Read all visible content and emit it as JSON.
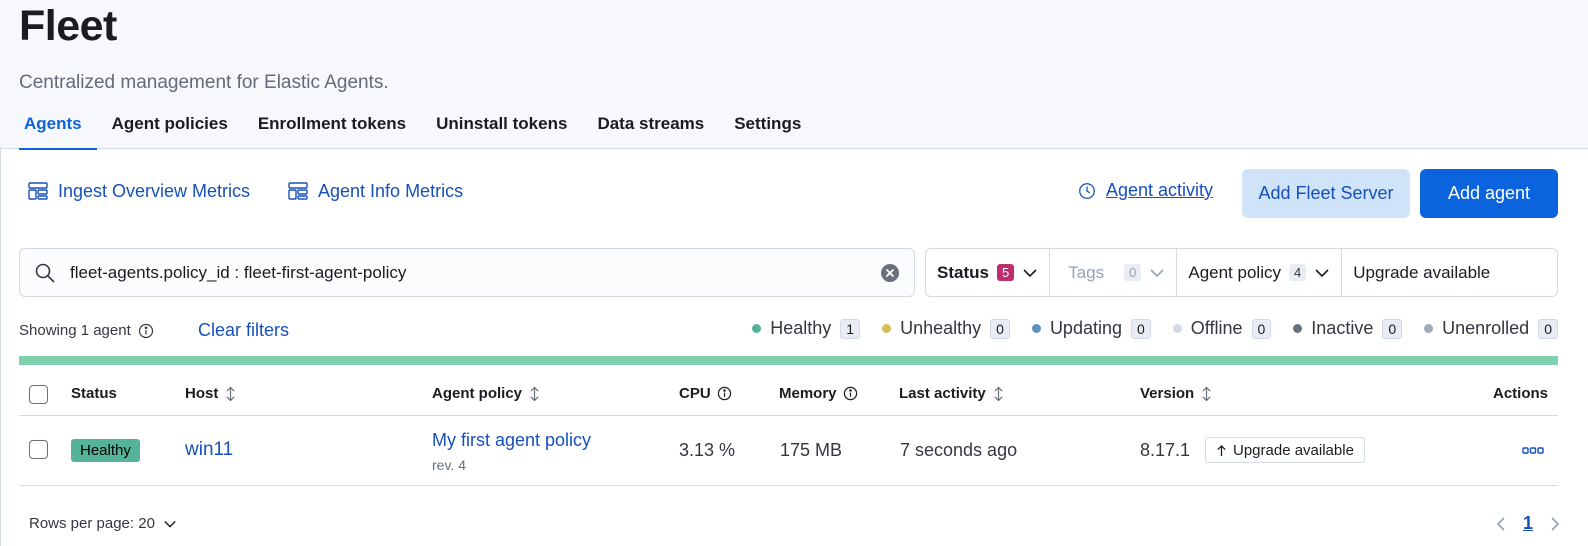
{
  "header": {
    "title": "Fleet",
    "description": "Centralized management for Elastic Agents."
  },
  "tabs": [
    {
      "label": "Agents",
      "active": true
    },
    {
      "label": "Agent policies"
    },
    {
      "label": "Enrollment tokens"
    },
    {
      "label": "Uninstall tokens"
    },
    {
      "label": "Data streams"
    },
    {
      "label": "Settings"
    }
  ],
  "toolbar": {
    "ingest_metrics": "Ingest Overview Metrics",
    "agent_info_metrics": "Agent Info Metrics",
    "agent_activity": "Agent activity",
    "add_fleet_server": "Add Fleet Server",
    "add_agent": "Add agent"
  },
  "search": {
    "value": "fleet-agents.policy_id : fleet-first-agent-policy"
  },
  "filters": {
    "status": {
      "label": "Status",
      "count": "5"
    },
    "tags": {
      "label": "Tags",
      "count": "0"
    },
    "agent_policy": {
      "label": "Agent policy",
      "count": "4"
    },
    "upgrade_available": {
      "label": "Upgrade available"
    }
  },
  "summary": {
    "showing": "Showing 1 agent",
    "clear_filters": "Clear filters",
    "statuses": [
      {
        "label": "Healthy",
        "count": "1",
        "color": "#54b399"
      },
      {
        "label": "Unhealthy",
        "count": "0",
        "color": "#d6bf57"
      },
      {
        "label": "Updating",
        "count": "0",
        "color": "#6092c0"
      },
      {
        "label": "Offline",
        "count": "0",
        "color": "#d3dae6"
      },
      {
        "label": "Inactive",
        "count": "0",
        "color": "#69707d"
      },
      {
        "label": "Unenrolled",
        "count": "0",
        "color": "#a2abba"
      }
    ]
  },
  "table": {
    "headers": {
      "status": "Status",
      "host": "Host",
      "agent_policy": "Agent policy",
      "cpu": "CPU",
      "memory": "Memory",
      "last_activity": "Last activity",
      "version": "Version",
      "actions": "Actions"
    },
    "rows": [
      {
        "status": "Healthy",
        "host": "win11",
        "policy": "My first agent policy",
        "policy_rev": "rev. 4",
        "cpu": "3.13 %",
        "memory": "175 MB",
        "last_activity": "7 seconds ago",
        "version": "8.17.1",
        "upgrade": "Upgrade available"
      }
    ]
  },
  "pagination": {
    "rows_per_page": "Rows per page: 20",
    "current_page": "1"
  }
}
